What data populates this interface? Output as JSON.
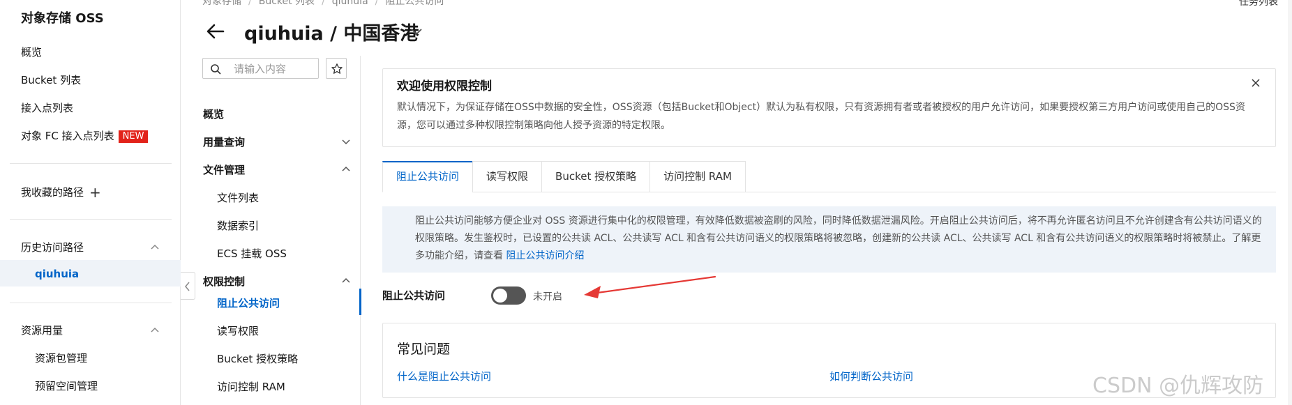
{
  "sidebar": {
    "title": "对象存储 OSS",
    "overview": "概览",
    "bucket_list": "Bucket 列表",
    "access_points": "接入点列表",
    "fc_access_points": "对象 FC 接入点列表",
    "new_badge": "NEW",
    "favorites": "我收藏的路径",
    "history": "历史访问路径",
    "history_active": "qiuhuia",
    "resource_usage": "资源用量",
    "resource_pack": "资源包管理",
    "reserved_space": "预留空间管理"
  },
  "header": {
    "breadcrumb": [
      "对象存储",
      "Bucket 列表",
      "qiuhuia",
      "阻止公共访问"
    ],
    "task_list": "任务列表",
    "title": "qiuhuia / 中国香港"
  },
  "bucket_nav": {
    "search_placeholder": "请输入内容",
    "overview": "概览",
    "usage_query": "用量查询",
    "file_mgmt": "文件管理",
    "file_list": "文件列表",
    "data_index": "数据索引",
    "ecs_mount": "ECS 挂载 OSS",
    "permission_ctrl": "权限控制",
    "block_public": "阻止公共访问",
    "rw_perm": "读写权限",
    "bucket_policy": "Bucket 授权策略",
    "ram": "访问控制 RAM"
  },
  "welcome": {
    "title": "欢迎使用权限控制",
    "text": "默认情况下，为保证存储在OSS中数据的安全性，OSS资源（包括Bucket和Object）默认为私有权限，只有资源拥有者或者被授权的用户允许访问，如果要授权第三方用户访问或使用自己的OSS资源，您可以通过多种权限控制策略向他人授予资源的特定权限。"
  },
  "tabs": [
    "阻止公共访问",
    "读写权限",
    "Bucket 授权策略",
    "访问控制 RAM"
  ],
  "notice": {
    "text": "阻止公共访问能够方便企业对 OSS 资源进行集中化的权限管理，有效降低数据被盗刷的风险，同时降低数据泄漏风险。开启阻止公共访问后，将不再允许匿名访问且不允许创建含有公共访问语义的权限策略。发生鉴权时，已设置的公共读 ACL、公共读写 ACL 和含有公共访问语义的权限策略将被忽略，创建新的公共读 ACL、公共读写 ACL 和含有公共访问语义的权限策略时将被禁止。了解更多功能介绍，请查看 ",
    "link": "阻止公共访问介绍"
  },
  "block_public_access": {
    "label": "阻止公共访问",
    "state": "未开启",
    "enabled": false
  },
  "faq": {
    "title": "常见问题",
    "link1": "什么是阻止公共访问",
    "link2": "如何判断公共访问"
  },
  "watermark": "CSDN @仇辉攻防",
  "colors": {
    "accent": "#0064c8",
    "new_badge": "#e2231a",
    "annotation_arrow": "#e53935",
    "switch_off": "#555555"
  }
}
